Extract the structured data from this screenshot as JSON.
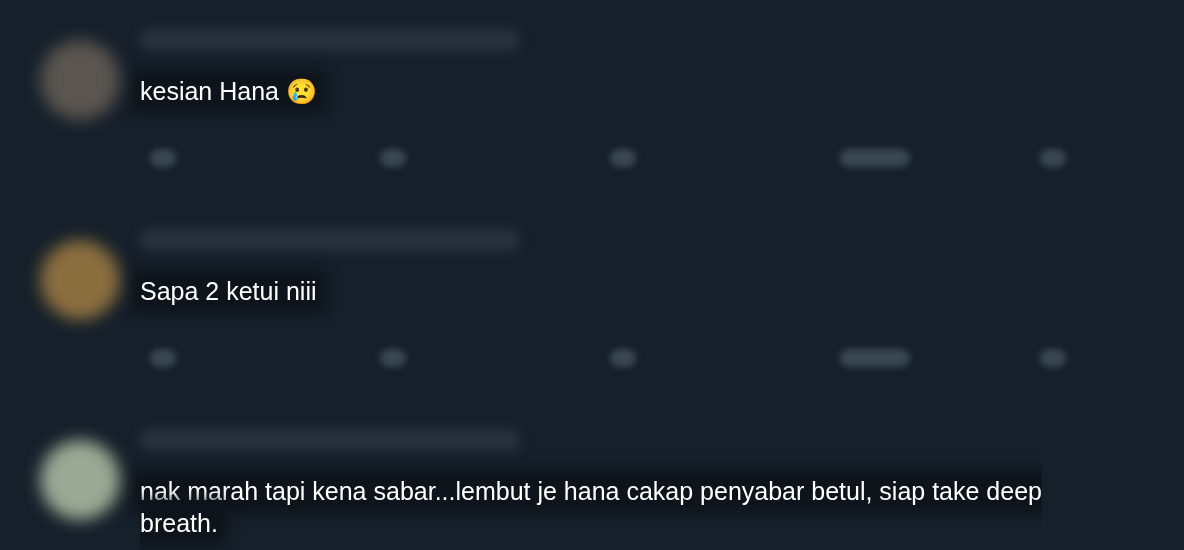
{
  "replies": [
    {
      "text": "kesian Hana 😢",
      "color": "#5a5550"
    },
    {
      "text": "Sapa 2 ketui niii",
      "color": "#8a6e3e"
    },
    {
      "text": "nak marah tapi kena sabar...lembut je hana cakap penyabar betul, siap take deep breath.",
      "color": "#9aa894"
    }
  ]
}
